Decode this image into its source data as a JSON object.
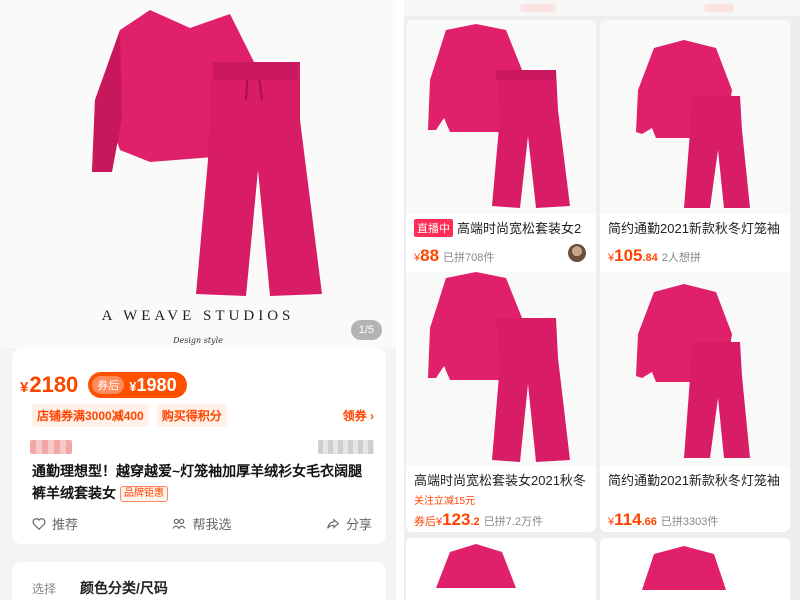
{
  "left": {
    "hero": {
      "brand": "A WEAVE STUDIOS",
      "brand_sub": "Design style",
      "pager": "1/5",
      "garment_color": "#e0206a"
    },
    "price": {
      "currency": "¥",
      "main": "2180",
      "coupon_tag": "券后",
      "coupon_currency": "¥",
      "coupon_value": "1980"
    },
    "promos": [
      "店铺券满3000减400",
      "购买得积分"
    ],
    "claim_label": "领券 ›",
    "title": "通勤理想型！越穿越爱~灯笼袖加厚羊绒衫女毛衣阔腿裤羊绒套装女",
    "title_tag": "品牌钜惠",
    "actions": [
      {
        "icon": "heart-icon",
        "label": "推荐"
      },
      {
        "icon": "people-icon",
        "label": "帮我选"
      },
      {
        "icon": "share-icon",
        "label": "分享"
      }
    ],
    "select": {
      "label": "选择",
      "value": "颜色分类/尺码"
    }
  },
  "products": [
    {
      "live_badge": "直播中",
      "title": "高端时尚宽松套装女2",
      "follow": "",
      "price_prefix": "",
      "currency": "¥",
      "price_int": "88",
      "price_dec": "",
      "sold": "已拼708件",
      "has_avatar": true
    },
    {
      "live_badge": "",
      "title": "简约通勤2021新款秋冬灯笼袖",
      "follow": "",
      "price_prefix": "",
      "currency": "¥",
      "price_int": "105",
      "price_dec": ".84",
      "sold": "2人想拼",
      "has_avatar": false
    },
    {
      "live_badge": "",
      "title": "高端时尚宽松套装女2021秋冬",
      "follow": "关注立减15元",
      "price_prefix": "券后",
      "currency": "¥",
      "price_int": "123",
      "price_dec": ".2",
      "sold": "已拼7.2万件",
      "has_avatar": false
    },
    {
      "live_badge": "",
      "title": "简约通勤2021新款秋冬灯笼袖",
      "follow": "",
      "price_prefix": "",
      "currency": "¥",
      "price_int": "114",
      "price_dec": ".66",
      "sold": "已拼3303件",
      "has_avatar": false
    }
  ],
  "colors": {
    "accent": "#ff4400",
    "coupon_bg": "#ff5000",
    "garment": "#e0206a",
    "live": "#ff2d55"
  }
}
